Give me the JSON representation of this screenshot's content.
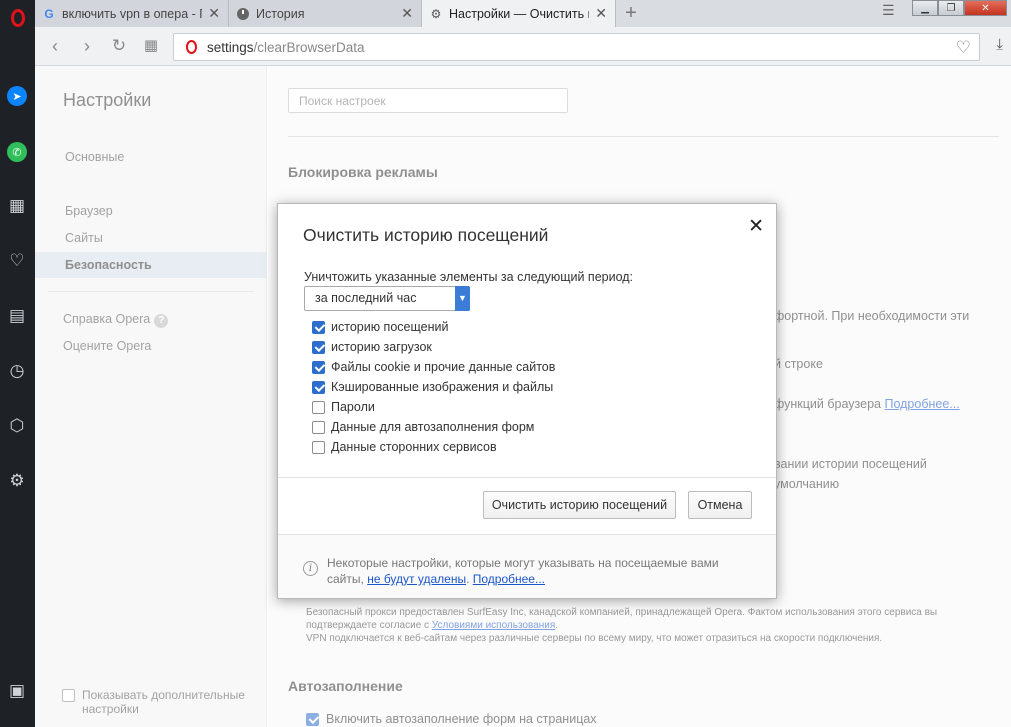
{
  "tabs": [
    {
      "label": "включить vpn в опера - Г",
      "icon": "google-icon",
      "active": false
    },
    {
      "label": "История",
      "icon": "history-icon",
      "active": false
    },
    {
      "label": "Настройки — Очистить и",
      "icon": "settings-icon",
      "active": true
    }
  ],
  "toolbar": {
    "url_host": "settings",
    "url_path": "/clearBrowserData"
  },
  "settings_nav": {
    "title": "Настройки",
    "items": [
      "Основные",
      "Браузер",
      "Сайты",
      "Безопасность"
    ],
    "selected": "Безопасность",
    "links": [
      "Справка Opera",
      "Оцените Opera"
    ],
    "show_advanced": "Показывать дополнительные настройки"
  },
  "main": {
    "search_placeholder": "Поиск настроек",
    "ad_block_title": "Блокировка рекламы",
    "bg_text_1": "фортной. При необходимости эти",
    "bg_text_2": "й строке",
    "bg_text_3": "функций браузера",
    "bg_link_more": "Подробнее...",
    "bg_text_4": "вании истории посещений",
    "bg_text_5": "умолчанию",
    "vpn_note_1": "Безопасный прокси предоставлен SurfEasy Inc, канадской компанией, принадлежащей Opera. Фактом использования этого сервиса вы",
    "vpn_note_2_pre": "подтверждаете согласие с",
    "vpn_note_2_link": "Условиями использования",
    "vpn_note_3": "VPN подключается к веб-сайтам через различные серверы по всему миру, что может отразиться на скорости подключения.",
    "autofill_title": "Автозаполнение",
    "autofill_option": "Включить автозаполнение форм на страницах"
  },
  "dialog": {
    "title": "Очистить историю посещений",
    "period_label": "Уничтожить указанные элементы за следующий период:",
    "period_value": "за последний час",
    "options": [
      {
        "label": "историю посещений",
        "checked": true
      },
      {
        "label": "историю загрузок",
        "checked": true
      },
      {
        "label": "Файлы cookie и прочие данные сайтов",
        "checked": true
      },
      {
        "label": "Кэшированные изображения и файлы",
        "checked": true
      },
      {
        "label": "Пароли",
        "checked": false
      },
      {
        "label": "Данные для автозаполнения форм",
        "checked": false
      },
      {
        "label": "Данные сторонних сервисов",
        "checked": false
      }
    ],
    "clear_button": "Очистить историю посещений",
    "cancel_button": "Отмена",
    "footer_text_1": "Некоторые настройки, которые могут указывать на посещаемые вами",
    "footer_text_2": "сайты,",
    "footer_link_1": "не будут удалены",
    "footer_link_2": "Подробнее..."
  },
  "colors": {
    "accent": "#2d6ecd",
    "opera_red": "#e2121b",
    "sidebar_bg": "#1e2227",
    "selected_nav_bg": "#d3dee7"
  }
}
